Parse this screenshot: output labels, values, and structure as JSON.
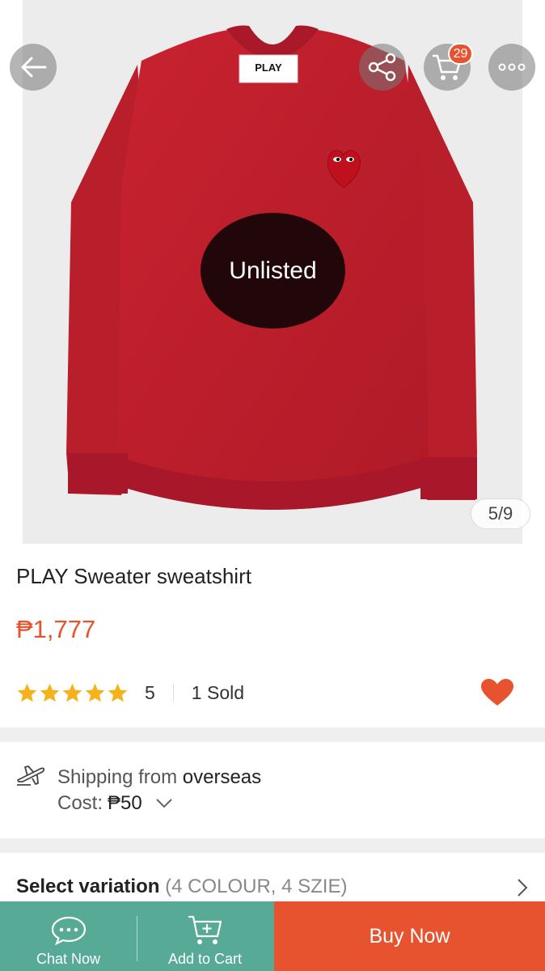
{
  "product_image": {
    "overlay_status": "Unlisted",
    "page_indicator": "5/9",
    "label_text": "PLAY",
    "sweater_color": "#c2202e"
  },
  "header": {
    "cart_count": "29",
    "icons": [
      "back-arrow-icon",
      "share-icon",
      "cart-icon",
      "more-icon"
    ]
  },
  "product": {
    "title": "PLAY Sweater sweatshirt",
    "price": "₱1,777",
    "rating": "5",
    "rating_stars": 5,
    "sold": "1 Sold"
  },
  "shipping": {
    "label": "Shipping from",
    "origin": "overseas",
    "cost_label": "Cost:",
    "cost_value": "₱50"
  },
  "variation": {
    "label": "Select variation",
    "detail": "(4 COLOUR, 4 SZIE)"
  },
  "bottom_bar": {
    "chat_label": "Chat Now",
    "add_cart_label": "Add to Cart",
    "buy_label": "Buy Now"
  },
  "colors": {
    "accent": "#e8532f",
    "teal": "#56aa96",
    "star": "#f5b21a"
  }
}
